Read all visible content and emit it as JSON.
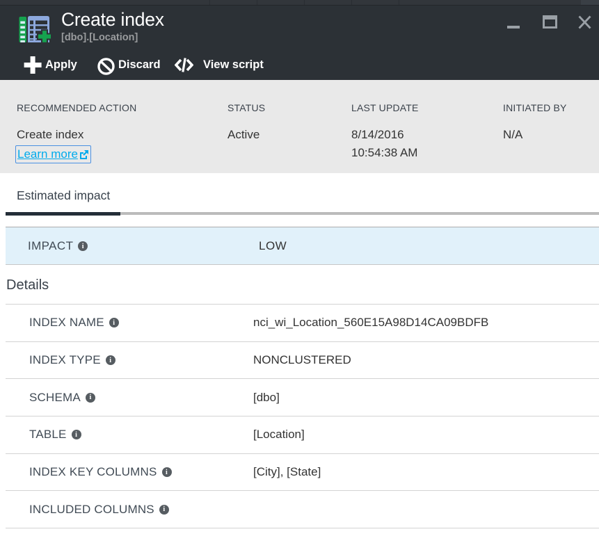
{
  "window": {
    "title": "Create index",
    "subtitle": "[dbo].[Location]"
  },
  "toolbar": {
    "apply": "Apply",
    "discard": "Discard",
    "view_script": "View script"
  },
  "summary": {
    "columns": [
      {
        "header": "RECOMMENDED ACTION",
        "value": "Create index",
        "link": "Learn more"
      },
      {
        "header": "STATUS",
        "value": "Active"
      },
      {
        "header": "LAST UPDATE",
        "value": "8/14/2016",
        "value2": "10:54:38 AM"
      },
      {
        "header": "INITIATED BY",
        "value": "N/A"
      }
    ]
  },
  "tabs": [
    {
      "label": "Estimated impact",
      "selected": true
    }
  ],
  "impact": {
    "label": "IMPACT",
    "value": "LOW"
  },
  "details": {
    "heading": "Details",
    "rows": [
      {
        "label": "INDEX NAME",
        "value": "nci_wi_Location_560E15A98D14CA09BDFB"
      },
      {
        "label": "INDEX TYPE",
        "value": "NONCLUSTERED"
      },
      {
        "label": "SCHEMA",
        "value": "[dbo]"
      },
      {
        "label": "TABLE",
        "value": "[Location]"
      },
      {
        "label": "INDEX KEY COLUMNS",
        "value": "[City], [State]"
      },
      {
        "label": "INCLUDED COLUMNS",
        "value": ""
      }
    ]
  },
  "colors": {
    "header_bg": "#2c3136",
    "summary_bg": "#e9e9e9",
    "impact_bg": "#e1f1fa",
    "link": "#00abec",
    "accent_green": "#18a24f",
    "accent_blue": "#8da9de"
  }
}
